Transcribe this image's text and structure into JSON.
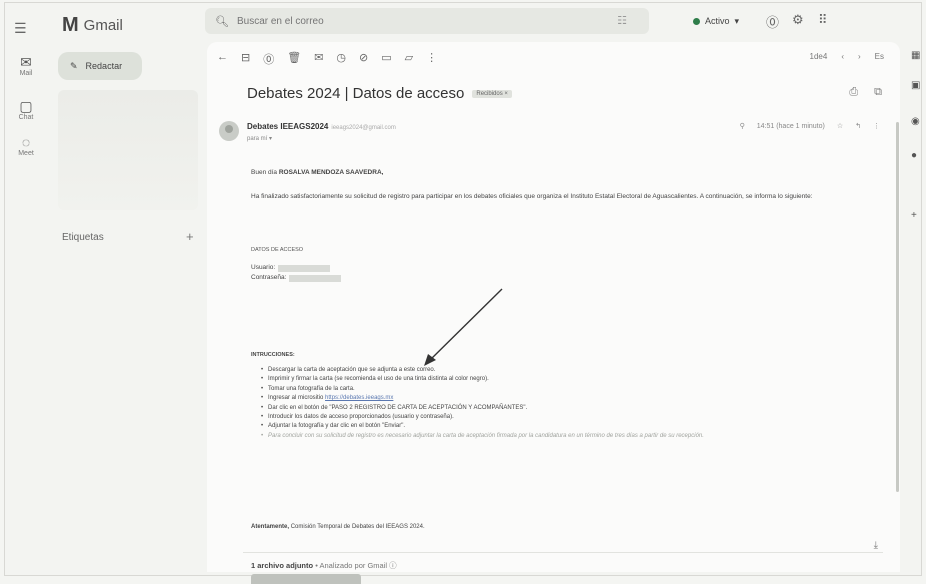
{
  "app": {
    "name": "Gmail",
    "logo_letter": "M"
  },
  "rail": {
    "items": [
      {
        "label": "Mail",
        "icon": "mail-icon",
        "badge_icon": "notification-dot"
      },
      {
        "label": "Chat",
        "icon": "chat-icon"
      },
      {
        "label": "Meet",
        "icon": "meet-icon"
      }
    ]
  },
  "header": {
    "search_placeholder": "Buscar en el correo",
    "status_label": "Activo",
    "status_color": "#2e7d4a"
  },
  "sidebar": {
    "compose_label": "Redactar",
    "labels_heading": "Etiquetas"
  },
  "toolbar": {
    "pager_text": "1de4",
    "lang": "Es"
  },
  "email": {
    "subject": "Debates 2024 | Datos de acceso",
    "tag": "Recibidos ×",
    "sender_name": "Debates IEEAGS2024",
    "sender_address": "ieeags2024@gmail.com",
    "to_line": "para mí ▾",
    "time": "14:51 (hace 1 minuto)",
    "greeting_prefix": "Buen día",
    "greeting_name": "ROSALVA MENDOZA SAAVEDRA,",
    "intro": "Ha finalizado satisfactoriamente su solicitud de registro para participar en los debates oficiales que organiza el Instituto Estatal Electoral de Aguascalientes. A continuación, se informa lo siguiente:",
    "access_title": "DATOS DE ACCESO",
    "user_label": "Usuario:",
    "password_label": "Contraseña:",
    "instructions_title": "INTRUCCIONES:",
    "instructions": [
      "Descargar la carta de aceptación que se adjunta a este correo.",
      "Imprimir y firmar la carta (se recomienda el uso de una tinta distinta al color negro).",
      "Tomar una fotografía de la carta.",
      "Ingresar al micrositio https://debates.ieeags.mx",
      "Dar clic en el botón de \"PASO 2 REGISTRO DE CARTA DE ACEPTACIÓN Y ACOMPAÑANTES\".",
      "Introducir los datos de acceso proporcionados (usuario y contraseña).",
      "Adjuntar la fotografía y dar clic en el botón \"Enviar\".",
      "Para concluir con su solicitud de registro es necesario adjuntar la carta de aceptación firmada por la candidatura en un término de tres días a partir de su recepción."
    ],
    "link_text": "https://debates.ieeags.mx",
    "closing_bold": "Atentamente,",
    "closing_rest": "Comisión Temporal de Debates del IEEAGS 2024.",
    "attachment_count": "1 archivo adjunto",
    "attachment_scan": "• Analizado por Gmail ⓘ"
  }
}
